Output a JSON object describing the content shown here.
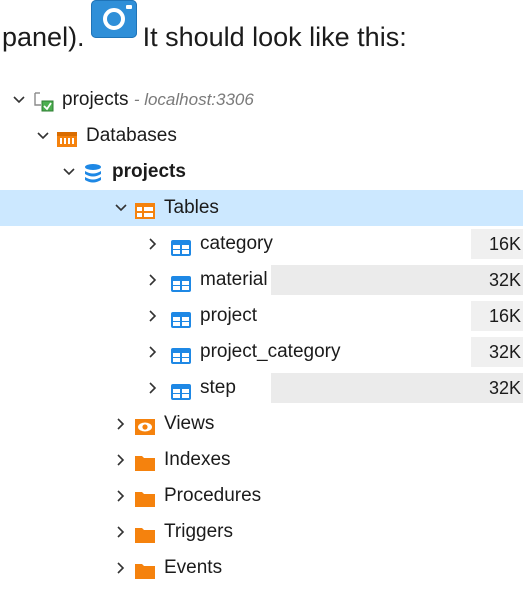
{
  "intro": {
    "before": "panel).",
    "after": "It should look like this:",
    "icon": "camera-icon"
  },
  "tree": {
    "connection": {
      "name": "projects",
      "host": "- localhost:3306",
      "icon": "server-connection-icon"
    },
    "databases": {
      "label": "Databases",
      "icon": "databases-folder-icon"
    },
    "database": {
      "name": "projects",
      "icon": "database-cylinder-icon"
    },
    "tables": {
      "label": "Tables",
      "icon": "tables-folder-icon",
      "items": [
        {
          "name": "category",
          "size": "16K"
        },
        {
          "name": "material",
          "size": "32K"
        },
        {
          "name": "project",
          "size": "16K"
        },
        {
          "name": "project_category",
          "size": "32K"
        },
        {
          "name": "step",
          "size": "32K"
        }
      ]
    },
    "folders": [
      {
        "label": "Views",
        "icon": "views-eye-icon"
      },
      {
        "label": "Indexes",
        "icon": "folder-icon"
      },
      {
        "label": "Procedures",
        "icon": "folder-icon"
      },
      {
        "label": "Triggers",
        "icon": "folder-icon"
      },
      {
        "label": "Events",
        "icon": "folder-icon"
      }
    ]
  },
  "colors": {
    "selected_row": "#cce8ff",
    "folder_orange": "#f5820d",
    "table_blue": "#1e88e5",
    "size_bg": "#ebebeb"
  }
}
